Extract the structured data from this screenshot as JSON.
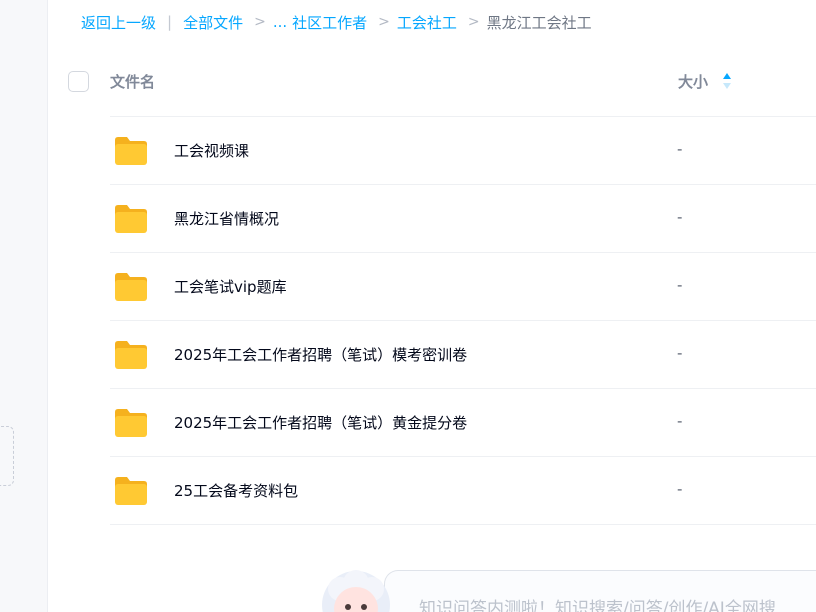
{
  "breadcrumb": {
    "back": "返回上一级",
    "all_files": "全部文件",
    "ellipsis": "...",
    "items": [
      "社区工作者",
      "工会社工"
    ],
    "current": "黑龙江工会社工",
    "separator": ">"
  },
  "header": {
    "name_col": "文件名",
    "size_col": "大小"
  },
  "files": [
    {
      "name": "工会视频课",
      "size": "-"
    },
    {
      "name": "黑龙江省情概况",
      "size": "-"
    },
    {
      "name": "工会笔试vip题库",
      "size": "-"
    },
    {
      "name": "2025年工会工作者招聘（笔试）模考密训卷",
      "size": "-"
    },
    {
      "name": "2025年工会工作者招聘（笔试）黄金提分卷",
      "size": "-"
    },
    {
      "name": "25工会备考资料包",
      "size": "-"
    }
  ],
  "assistant": {
    "text": "知识问答内测啦！知识搜索/问答/创作/AI全网搜"
  },
  "colors": {
    "link": "#06a7ff",
    "folder": "#ffc933",
    "folder_tab": "#f5b11e"
  }
}
